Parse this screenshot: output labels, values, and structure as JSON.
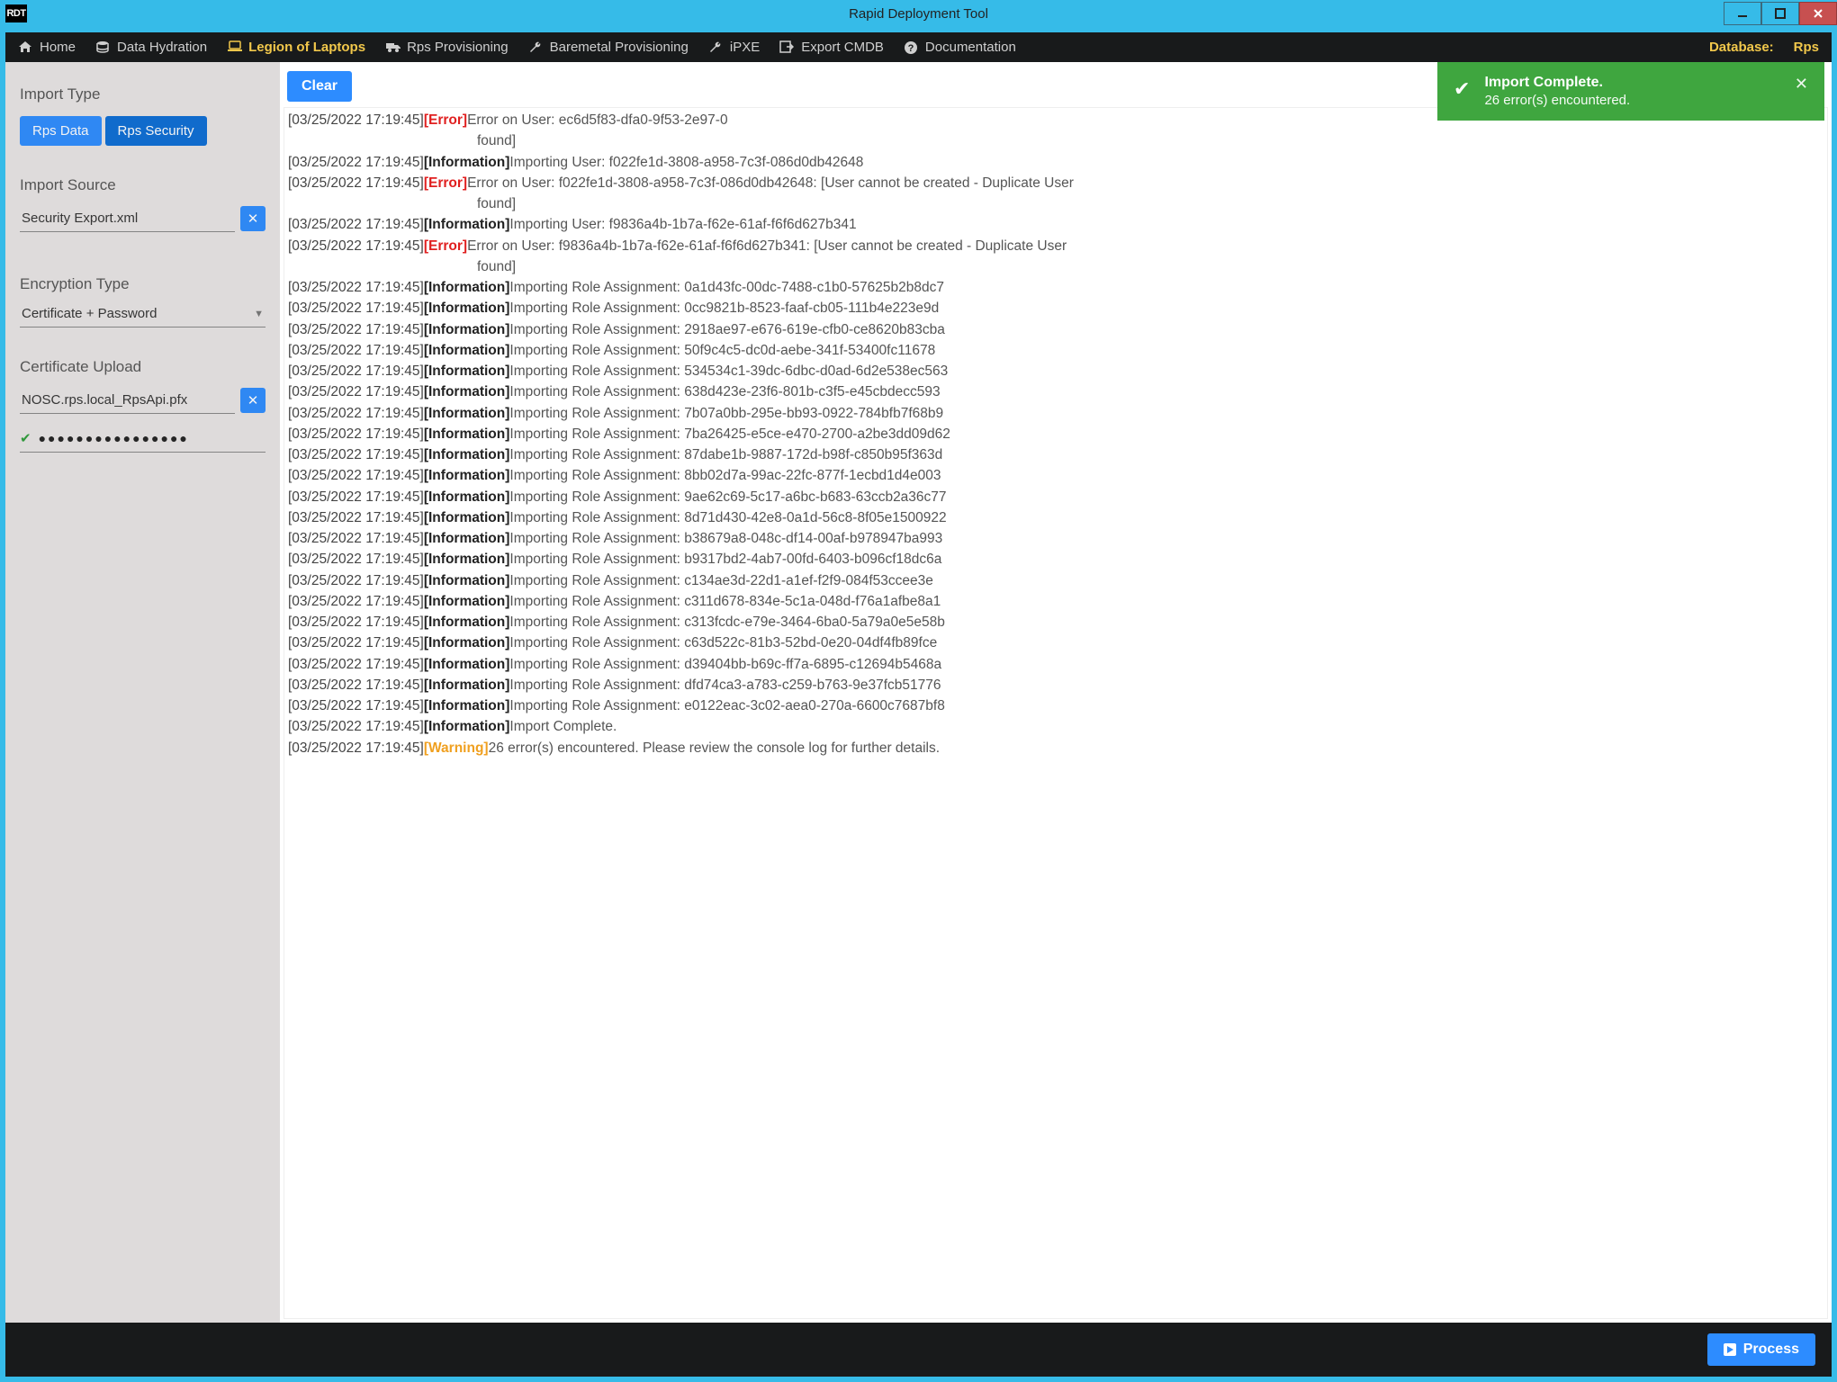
{
  "window": {
    "title": "Rapid Deployment Tool",
    "icon_text": "RDT"
  },
  "nav": {
    "items": [
      {
        "label": "Home",
        "icon": "home-icon"
      },
      {
        "label": "Data Hydration",
        "icon": "stack-icon"
      },
      {
        "label": "Legion of Laptops",
        "icon": "laptop-icon",
        "active": true
      },
      {
        "label": "Rps Provisioning",
        "icon": "truck-icon"
      },
      {
        "label": "Baremetal Provisioning",
        "icon": "wrench-icon"
      },
      {
        "label": "iPXE",
        "icon": "wrench-icon"
      },
      {
        "label": "Export CMDB",
        "icon": "export-icon"
      },
      {
        "label": "Documentation",
        "icon": "help-icon"
      }
    ],
    "database_label": "Database:",
    "database_value": "Rps"
  },
  "sidebar": {
    "import_type_label": "Import Type",
    "import_type_options": [
      "Rps Data",
      "Rps Security"
    ],
    "import_type_selected": "Rps Data",
    "import_source_label": "Import Source",
    "import_source_value": "Security Export.xml",
    "encryption_type_label": "Encryption Type",
    "encryption_type_value": "Certificate + Password",
    "certificate_upload_label": "Certificate Upload",
    "certificate_file_value": "NOSC.rps.local_RpsApi.pfx",
    "password_mask": "●●●●●●●●●●●●●●●●"
  },
  "toolbar": {
    "clear_label": "Clear"
  },
  "toast": {
    "title": "Import Complete.",
    "subtitle": "26 error(s) encountered."
  },
  "footer": {
    "process_label": "Process"
  },
  "log": [
    {
      "ts": "[03/25/2022 17:19:45]",
      "level": "Error",
      "msg": "Error on User: ec6d5f83-dfa0-9f53-2e97-0",
      "cont": "found]"
    },
    {
      "ts": "[03/25/2022 17:19:45]",
      "level": "Information",
      "msg": "Importing User: f022fe1d-3808-a958-7c3f-086d0db42648"
    },
    {
      "ts": "[03/25/2022 17:19:45]",
      "level": "Error",
      "msg": "Error on User: f022fe1d-3808-a958-7c3f-086d0db42648: [User cannot be created - Duplicate User",
      "cont": "found]"
    },
    {
      "ts": "[03/25/2022 17:19:45]",
      "level": "Information",
      "msg": "Importing User: f9836a4b-1b7a-f62e-61af-f6f6d627b341"
    },
    {
      "ts": "[03/25/2022 17:19:45]",
      "level": "Error",
      "msg": "Error on User: f9836a4b-1b7a-f62e-61af-f6f6d627b341: [User cannot be created - Duplicate User",
      "cont": "found]"
    },
    {
      "ts": "[03/25/2022 17:19:45]",
      "level": "Information",
      "msg": "Importing Role Assignment: 0a1d43fc-00dc-7488-c1b0-57625b2b8dc7"
    },
    {
      "ts": "[03/25/2022 17:19:45]",
      "level": "Information",
      "msg": "Importing Role Assignment: 0cc9821b-8523-faaf-cb05-111b4e223e9d"
    },
    {
      "ts": "[03/25/2022 17:19:45]",
      "level": "Information",
      "msg": "Importing Role Assignment: 2918ae97-e676-619e-cfb0-ce8620b83cba"
    },
    {
      "ts": "[03/25/2022 17:19:45]",
      "level": "Information",
      "msg": "Importing Role Assignment: 50f9c4c5-dc0d-aebe-341f-53400fc11678"
    },
    {
      "ts": "[03/25/2022 17:19:45]",
      "level": "Information",
      "msg": "Importing Role Assignment: 534534c1-39dc-6dbc-d0ad-6d2e538ec563"
    },
    {
      "ts": "[03/25/2022 17:19:45]",
      "level": "Information",
      "msg": "Importing Role Assignment: 638d423e-23f6-801b-c3f5-e45cbdecc593"
    },
    {
      "ts": "[03/25/2022 17:19:45]",
      "level": "Information",
      "msg": "Importing Role Assignment: 7b07a0bb-295e-bb93-0922-784bfb7f68b9"
    },
    {
      "ts": "[03/25/2022 17:19:45]",
      "level": "Information",
      "msg": "Importing Role Assignment: 7ba26425-e5ce-e470-2700-a2be3dd09d62"
    },
    {
      "ts": "[03/25/2022 17:19:45]",
      "level": "Information",
      "msg": "Importing Role Assignment: 87dabe1b-9887-172d-b98f-c850b95f363d"
    },
    {
      "ts": "[03/25/2022 17:19:45]",
      "level": "Information",
      "msg": "Importing Role Assignment: 8bb02d7a-99ac-22fc-877f-1ecbd1d4e003"
    },
    {
      "ts": "[03/25/2022 17:19:45]",
      "level": "Information",
      "msg": "Importing Role Assignment: 9ae62c69-5c17-a6bc-b683-63ccb2a36c77"
    },
    {
      "ts": "[03/25/2022 17:19:45]",
      "level": "Information",
      "msg": "Importing Role Assignment: 8d71d430-42e8-0a1d-56c8-8f05e1500922"
    },
    {
      "ts": "[03/25/2022 17:19:45]",
      "level": "Information",
      "msg": "Importing Role Assignment: b38679a8-048c-df14-00af-b978947ba993"
    },
    {
      "ts": "[03/25/2022 17:19:45]",
      "level": "Information",
      "msg": "Importing Role Assignment: b9317bd2-4ab7-00fd-6403-b096cf18dc6a"
    },
    {
      "ts": "[03/25/2022 17:19:45]",
      "level": "Information",
      "msg": "Importing Role Assignment: c134ae3d-22d1-a1ef-f2f9-084f53ccee3e"
    },
    {
      "ts": "[03/25/2022 17:19:45]",
      "level": "Information",
      "msg": "Importing Role Assignment: c311d678-834e-5c1a-048d-f76a1afbe8a1"
    },
    {
      "ts": "[03/25/2022 17:19:45]",
      "level": "Information",
      "msg": "Importing Role Assignment: c313fcdc-e79e-3464-6ba0-5a79a0e5e58b"
    },
    {
      "ts": "[03/25/2022 17:19:45]",
      "level": "Information",
      "msg": "Importing Role Assignment: c63d522c-81b3-52bd-0e20-04df4fb89fce"
    },
    {
      "ts": "[03/25/2022 17:19:45]",
      "level": "Information",
      "msg": "Importing Role Assignment: d39404bb-b69c-ff7a-6895-c12694b5468a"
    },
    {
      "ts": "[03/25/2022 17:19:45]",
      "level": "Information",
      "msg": "Importing Role Assignment: dfd74ca3-a783-c259-b763-9e37fcb51776"
    },
    {
      "ts": "[03/25/2022 17:19:45]",
      "level": "Information",
      "msg": "Importing Role Assignment: e0122eac-3c02-aea0-270a-6600c7687bf8"
    },
    {
      "ts": "[03/25/2022 17:19:45]",
      "level": "Information",
      "msg": "Import Complete."
    },
    {
      "ts": "[03/25/2022 17:19:45]",
      "level": "Warning",
      "msg": "26 error(s) encountered. Please review the console log for further details."
    }
  ]
}
